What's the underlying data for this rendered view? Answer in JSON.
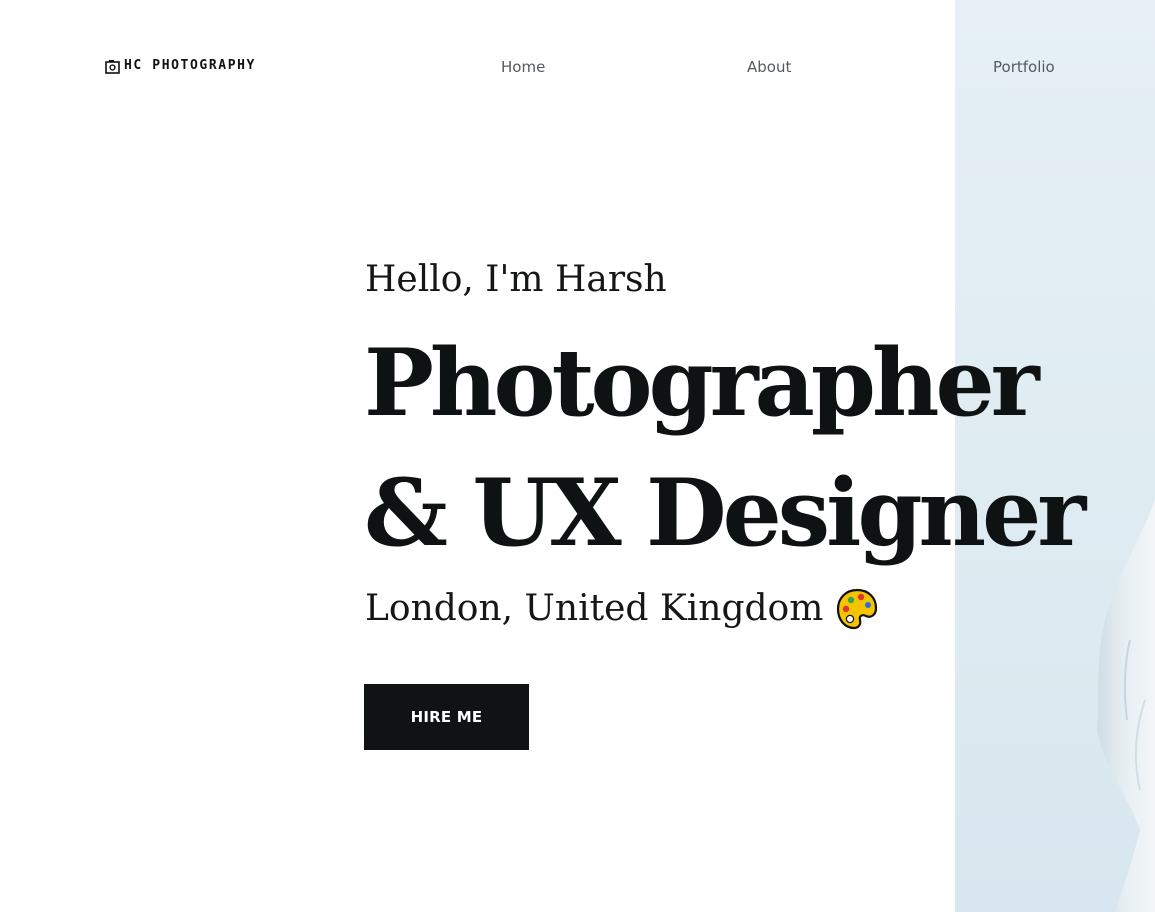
{
  "header": {
    "logo_text": "HC PHOTOGRAPHY",
    "logo_icon": "camera-icon",
    "nav": {
      "home": "Home",
      "about": "About",
      "portfolio": "Portfolio"
    }
  },
  "hero": {
    "greeting": "Hello, I'm Harsh",
    "headline_line1": "Photographer",
    "headline_line2": "& UX Designer",
    "location": "London, United Kingdom",
    "location_icon": "artist-palette-icon",
    "cta_label": "HIRE ME"
  },
  "colors": {
    "text": "#0f1213",
    "nav_text": "#555a5e",
    "button_bg": "#101314",
    "photo_bg": "#dfecf2"
  }
}
